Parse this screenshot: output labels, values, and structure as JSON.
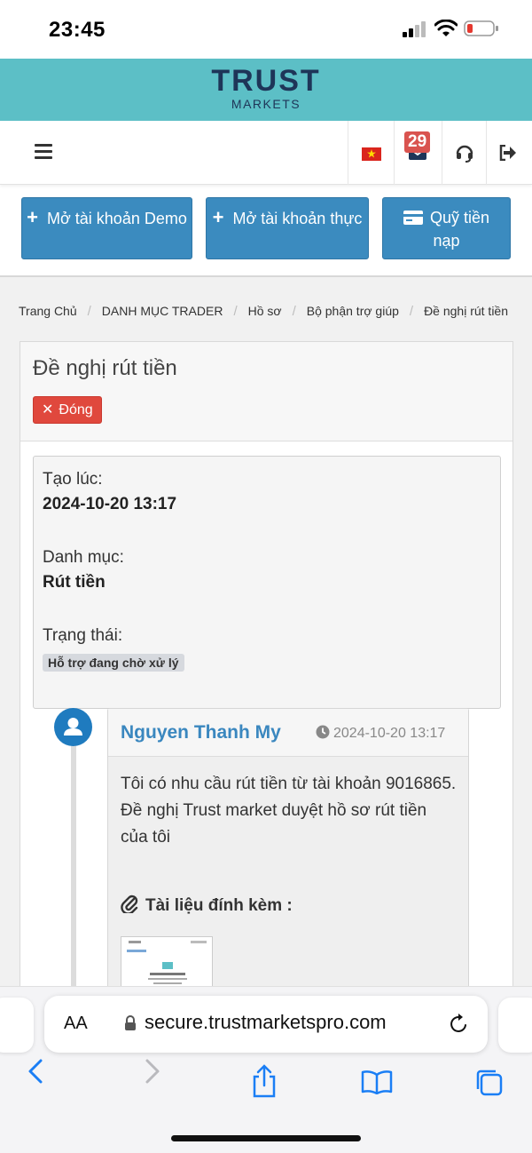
{
  "status_bar": {
    "time": "23:45"
  },
  "brand": {
    "name": "TRUST",
    "sub": "MARKETS"
  },
  "navbar": {
    "notification_count": "29"
  },
  "actions": {
    "demo_label": "Mở tài khoản Demo",
    "real_label": "Mở tài khoản thực",
    "deposit_label": "Quỹ tiền nạp"
  },
  "breadcrumb": [
    "Trang Chủ",
    "DANH MỤC TRADER",
    "Hồ sơ",
    "Bộ phận trợ giúp",
    "Đề nghị rút tiền"
  ],
  "ticket": {
    "title": "Đề nghị rút tiền",
    "close_label": "Đóng",
    "created_label": "Tạo lúc:",
    "created_value": "2024-10-20 13:17",
    "category_label": "Danh mục:",
    "category_value": "Rút tiền",
    "status_label": "Trạng thái:",
    "status_value": "Hỗ trợ đang chờ xử lý"
  },
  "comment": {
    "author": "Nguyen Thanh My",
    "time": "2024-10-20 13:17",
    "text": "Tôi có nhu cầu rút tiền từ tài khoản 9016865. Đề nghị Trust market duyệt hồ sơ rút tiền của tôi",
    "attachments_label": "Tài liệu đính kèm :"
  },
  "browser": {
    "aa_label": "AA",
    "url": "secure.trustmarketspro.com"
  },
  "icons": [
    "signal-icon",
    "wifi-icon",
    "battery-icon",
    "hamburger-icon",
    "vietnam-flag-icon",
    "envelope-icon",
    "headset-icon",
    "sign-out-icon",
    "plus-icon",
    "credit-card-icon",
    "clock-icon",
    "paperclip-icon",
    "user-icon",
    "lock-icon",
    "reload-icon",
    "back-icon",
    "forward-icon",
    "share-icon",
    "bookmarks-icon",
    "tabs-icon"
  ],
  "colors": {
    "brand": "#5cbfc6",
    "button": "#3b8bbf",
    "danger": "#e0483d",
    "author": "#3a87bf"
  }
}
